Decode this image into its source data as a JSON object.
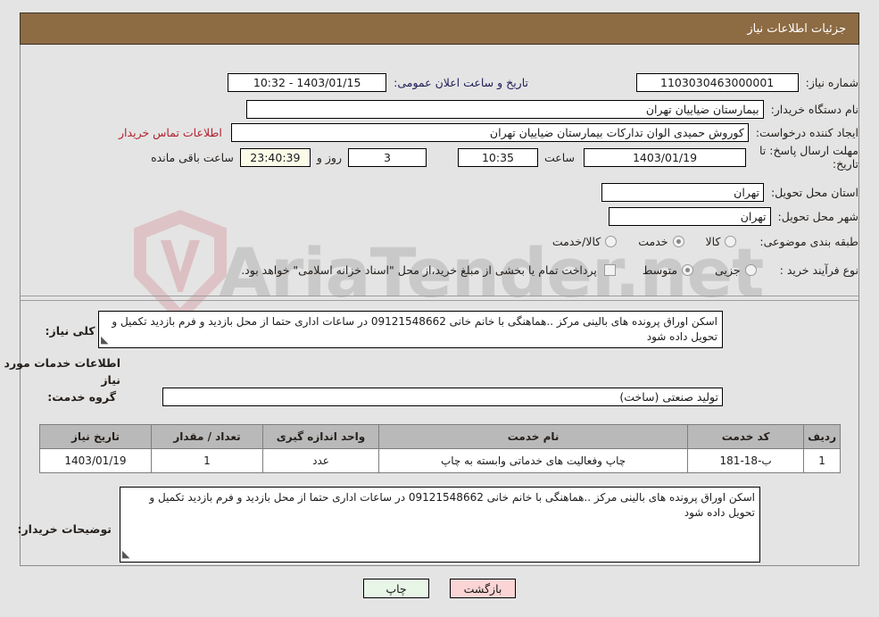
{
  "header": {
    "title": "جزئیات اطلاعات نیاز"
  },
  "fields": {
    "need_number_label": "شماره نیاز:",
    "need_number_value": "1103030463000001",
    "announce_label": "تاریخ و ساعت اعلان عمومی:",
    "announce_value": "1403/01/15 - 10:32",
    "buyer_org_label": "نام دستگاه خریدار:",
    "buyer_org_value": "بیمارستان ضیاییان تهران",
    "creator_label": "ایجاد کننده درخواست:",
    "creator_value": "کوروش حمیدی الوان تدارکات بیمارستان ضیاییان تهران",
    "contact_link": "اطلاعات تماس خریدار",
    "deadline_label": "مهلت ارسال پاسخ: تا تاریخ:",
    "deadline_date": "1403/01/19",
    "hour_label": "ساعت",
    "deadline_time": "10:35",
    "days_value": "3",
    "days_label": "روز و",
    "countdown_value": "23:40:39",
    "remaining_label": "ساعت باقی مانده",
    "province_label": "استان محل تحویل:",
    "province_value": "تهران",
    "city_label": "شهر محل تحویل:",
    "city_value": "تهران",
    "category_label": "طبقه بندی موضوعی:",
    "category_options": [
      {
        "label": "کالا",
        "selected": false
      },
      {
        "label": "خدمت",
        "selected": true
      },
      {
        "label": "کالا/خدمت",
        "selected": false
      }
    ],
    "process_label": "نوع فرآیند خرید :",
    "process_options": [
      {
        "label": "جزیی",
        "selected": false
      },
      {
        "label": "متوسط",
        "selected": true
      }
    ],
    "treasury_note": "پرداخت تمام یا بخشی از مبلغ خرید،از محل \"اسناد خزانه اسلامی\" خواهد بود."
  },
  "description": {
    "label": "شرح کلی نیاز:",
    "value": "اسکن اوراق پرونده های بالینی مرکز ..هماهنگی با خانم خانی 09121548662 در ساعات اداری حتما از محل بازدید و فرم بازدید تکمیل و تحویل داده شود"
  },
  "services_section": {
    "heading": "اطلاعات خدمات مورد نیاز",
    "group_label": "گروه خدمت:",
    "group_value": "تولید صنعتی (ساخت)"
  },
  "table": {
    "headers": [
      "ردیف",
      "کد خدمت",
      "نام خدمت",
      "واحد اندازه گیری",
      "تعداد / مقدار",
      "تاریخ نیاز"
    ],
    "rows": [
      {
        "row_no": "1",
        "service_code": "ب-18-181",
        "service_name": "چاپ وفعالیت های خدماتی وابسته به چاپ",
        "unit": "عدد",
        "quantity": "1",
        "need_date": "1403/01/19"
      }
    ]
  },
  "buyer_notes": {
    "label": "توضیحات خریدار:",
    "value": "اسکن اوراق پرونده های بالینی مرکز ..هماهنگی با خانم خانی 09121548662 در ساعات اداری حتما از محل بازدید و فرم بازدید تکمیل و تحویل داده شود"
  },
  "buttons": {
    "print": "چاپ",
    "back": "بازگشت"
  },
  "watermark": {
    "text": "AriaTender.net"
  },
  "colors": {
    "header_bg": "#8d6b43",
    "link_red": "#b3202c",
    "table_header_bg": "#b9b9b9",
    "btn_print_bg": "#e8f6e8",
    "btn_back_bg": "#fbd5d5",
    "countdown_bg": "#fbfbe8"
  }
}
